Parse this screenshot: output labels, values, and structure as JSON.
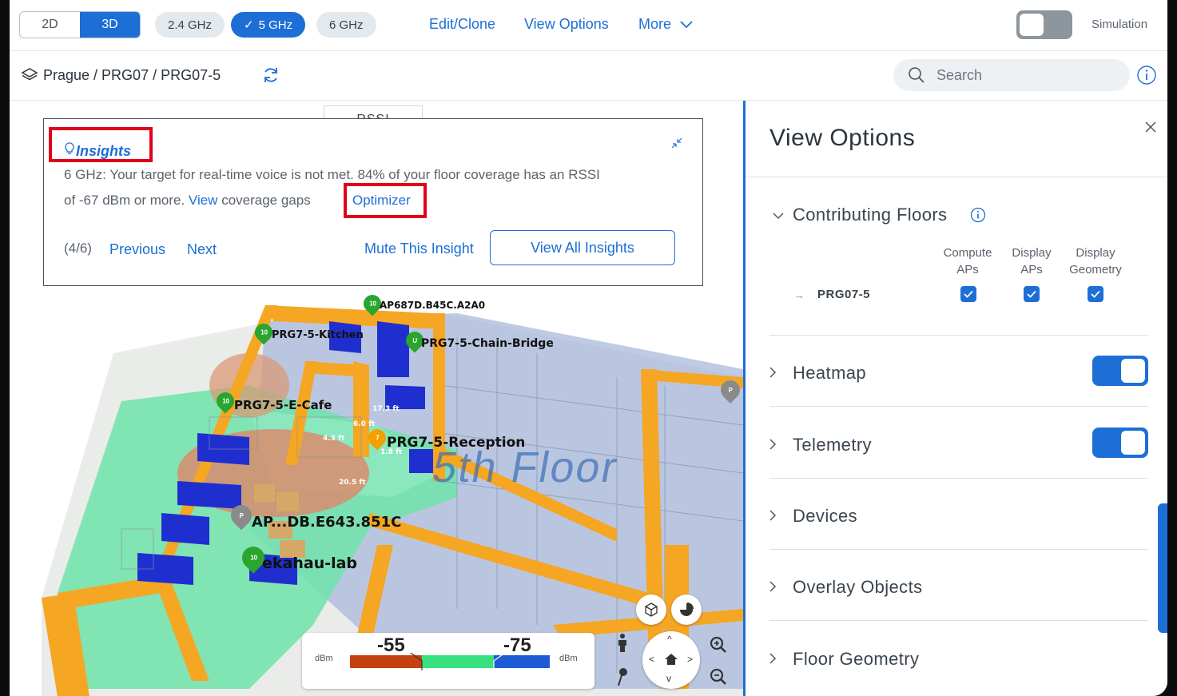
{
  "toolbar": {
    "view_modes": [
      "2D",
      "3D"
    ],
    "bands": [
      "2.4 GHz",
      "5 GHz",
      "6 GHz"
    ],
    "selected_band_check": "✓",
    "links": [
      "Edit/Clone",
      "View Options",
      "More"
    ],
    "simulation_label": "Simulation"
  },
  "breadcrumb": {
    "path": "Prague / PRG07 / PRG07-5",
    "search_placeholder": "Search"
  },
  "map": {
    "rssi_tab": "RSSI",
    "floor_label": "5th Floor",
    "access_points": [
      {
        "name": "AP687D.B45C.A2A0",
        "badge": "10",
        "color": "#2aa52e"
      },
      {
        "name": "PRG7-5-Kitchen",
        "badge": "10",
        "color": "#2aa52e"
      },
      {
        "name": "PRG7-5-Chain-Bridge",
        "badge": "U",
        "color": "#2aa52e"
      },
      {
        "name": "PRG7-5-E-Cafe",
        "badge": "10",
        "color": "#2aa52e"
      },
      {
        "name": "PRG7-5-Reception",
        "badge": "7",
        "color": "#f2a000"
      },
      {
        "name": "AP...DB.E643.851C",
        "badge": "P",
        "color": "#8a8a8a"
      },
      {
        "name": "ekahau-lab",
        "badge": "10",
        "color": "#2aa52e"
      }
    ],
    "distances": [
      "17.3 ft",
      "6.0 ft",
      "4.3 ft",
      "1.8 ft",
      "20.5 ft"
    ],
    "legend": {
      "unit": "dBm",
      "high": "-55",
      "low": "-75"
    }
  },
  "insights": {
    "title": "Insights",
    "line1": "6 GHz: Your target for real-time voice is not met. 84% of your floor coverage has an RSSI",
    "line2_prefix": "of -67 dBm or more.",
    "view_link": "View",
    "line2_suffix": "coverage gaps",
    "optimizer": "Optimizer",
    "counter": "(4/6)",
    "previous": "Previous",
    "next": "Next",
    "mute": "Mute This Insight",
    "view_all": "View All Insights"
  },
  "panel": {
    "title": "View Options",
    "contributing": {
      "title": "Contributing Floors",
      "columns": [
        "Compute APs",
        "Display APs",
        "Display Geometry"
      ],
      "floor": "PRG07-5",
      "arrow": "→",
      "checked": [
        true,
        true,
        true
      ]
    },
    "sections": [
      {
        "label": "Heatmap",
        "toggle": true
      },
      {
        "label": "Telemetry",
        "toggle": true
      },
      {
        "label": "Devices",
        "toggle": null
      },
      {
        "label": "Overlay Objects",
        "toggle": null
      },
      {
        "label": "Floor Geometry",
        "toggle": null
      }
    ]
  },
  "colors": {
    "accent": "#1d6fd6",
    "highlight_box": "#e0001b",
    "wall": "#f5a623",
    "room_blue": "#1f2fcf"
  },
  "icons": [
    "layers-icon",
    "refresh-icon",
    "search-icon",
    "info-icon",
    "bulb-icon",
    "collapse-icon",
    "close-icon",
    "chevron-down-icon",
    "chevron-right-icon",
    "info-icon",
    "check-icon",
    "cube-icon",
    "pie-icon",
    "person-icon",
    "pin-icon",
    "home-icon",
    "zoom-in-icon",
    "zoom-out-icon"
  ]
}
